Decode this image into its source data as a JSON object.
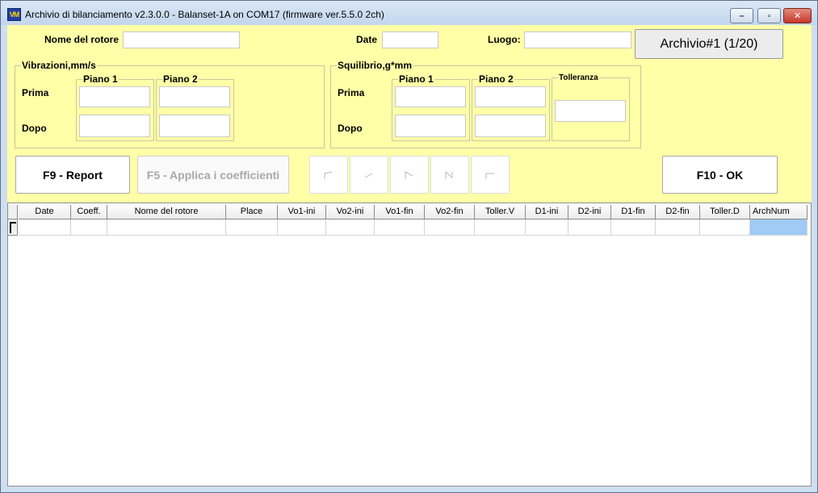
{
  "window": {
    "title": "Archivio di bilanciamento v2.3.0.0 - Balanset-1A on COM17 (firmware ver.5.5.0 2ch)",
    "app_icon": "VM",
    "controls": {
      "minimize": "–",
      "maximize": "▫",
      "close": "✕"
    }
  },
  "header": {
    "rotor_name_label": "Nome del rotore",
    "rotor_name_value": "",
    "date_label": "Date",
    "date_value": "",
    "place_label": "Luogo:",
    "place_value": "",
    "archive_button": "Archivio#1 (1/20)"
  },
  "vibrations": {
    "title": "Vibrazioni,mm/s",
    "plane1": "Piano 1",
    "plane2": "Piano 2",
    "before": "Prima",
    "after": "Dopo"
  },
  "unbalance": {
    "title": "Squilibrio,g*mm",
    "plane1": "Piano 1",
    "plane2": "Piano 2",
    "tolerance": "Tolleranza",
    "before": "Prima",
    "after": "Dopo"
  },
  "buttons": {
    "report": "F9 - Report",
    "apply": "F5 - Applica i coefficienti",
    "ok": "F10 - OK",
    "nav_icons": [
      "first-record-icon",
      "prev-record-icon",
      "next-record-icon",
      "last-record-icon",
      "end-record-icon"
    ]
  },
  "table": {
    "columns": [
      "Date",
      "Coeff.",
      "Nome del rotore",
      "Place",
      "Vo1-ini",
      "Vo2-ini",
      "Vo1-fin",
      "Vo2-fin",
      "Toller.V",
      "D1-ini",
      "D2-ini",
      "D1-fin",
      "D2-fin",
      "Toller.D",
      "ArchNum"
    ],
    "rows": [
      [
        "",
        "",
        "",
        "",
        "",
        "",
        "",
        "",
        "",
        "",
        "",
        "",
        "",
        "",
        ""
      ]
    ]
  },
  "colors": {
    "panel_bg": "#ffffa8",
    "selected_cell": "#9fcbf5",
    "window_frame": "#cfdff0"
  }
}
